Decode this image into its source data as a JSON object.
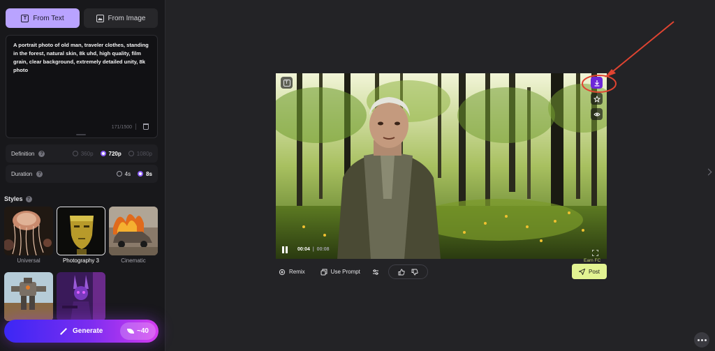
{
  "left_panel": {
    "tabs": [
      {
        "label": "From Text",
        "icon": "text-icon",
        "active": true
      },
      {
        "label": "From Image",
        "icon": "image-icon",
        "active": false
      }
    ],
    "prompt": {
      "text": "A portrait photo of old man, traveler clothes, standing in the forest, natural skin, 8k uhd, high quality, film grain, clear background, extremely detailed unity, 8k photo",
      "char_count": "171/1500"
    },
    "definition": {
      "label": "Definition",
      "options": [
        "360p",
        "720p",
        "1080p"
      ],
      "selected": "720p"
    },
    "duration": {
      "label": "Duration",
      "options": [
        "4s",
        "8s"
      ],
      "selected": "8s"
    },
    "styles": {
      "label": "Styles",
      "items": [
        {
          "label": "Universal",
          "selected": false
        },
        {
          "label": "Photography 3",
          "selected": true
        },
        {
          "label": "Cinematic",
          "selected": false
        }
      ]
    },
    "generate": {
      "label": "Generate",
      "cost": "~40"
    }
  },
  "player": {
    "current_time": "00:04",
    "duration": "00:08",
    "progress": 0.5
  },
  "actions": {
    "remix": "Remix",
    "use_prompt": "Use Prompt"
  },
  "post": {
    "earn_label": "Earn FC",
    "label": "Post"
  },
  "colors": {
    "accent": "#b9a3ff",
    "radio_selected": "#8b5cf6",
    "download_button": "#6d28d9",
    "post_button": "#e2f392",
    "annotation": "#e04431"
  }
}
